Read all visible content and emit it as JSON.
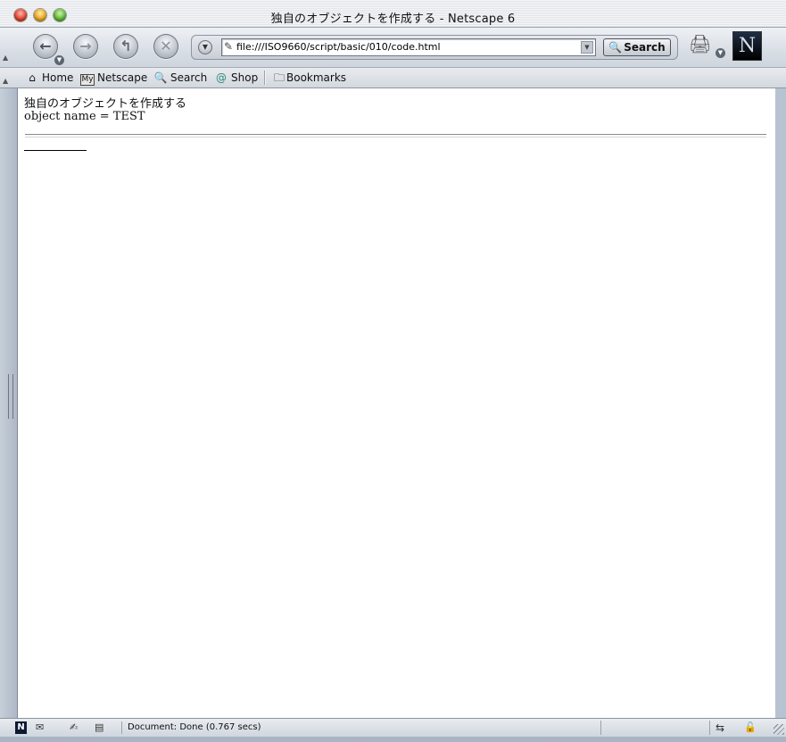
{
  "window": {
    "title": "独自のオブジェクトを作成する - Netscape 6"
  },
  "navigation": {
    "url": "file:///ISO9660/script/basic/010/code.html",
    "search_label": "Search",
    "brand_letter": "N"
  },
  "personal_toolbar": {
    "items": [
      {
        "label": "Home",
        "icon": "house-icon"
      },
      {
        "label": "Netscape",
        "icon": "my-netscape-icon",
        "icon_text": "My"
      },
      {
        "label": "Search",
        "icon": "magnifier-icon"
      },
      {
        "label": "Shop",
        "icon": "shop-icon"
      },
      {
        "label": "Bookmarks",
        "icon": "folder-icon"
      }
    ]
  },
  "content": {
    "heading_text": "独自のオブジェクトを作成する",
    "output_text": "object name = TEST"
  },
  "status": {
    "text": "Document: Done (0.767 secs)"
  },
  "colors": {
    "window_chrome": "#b8c3d1",
    "content_bg": "#ffffff",
    "throbber_bg": "#0d1a33"
  }
}
